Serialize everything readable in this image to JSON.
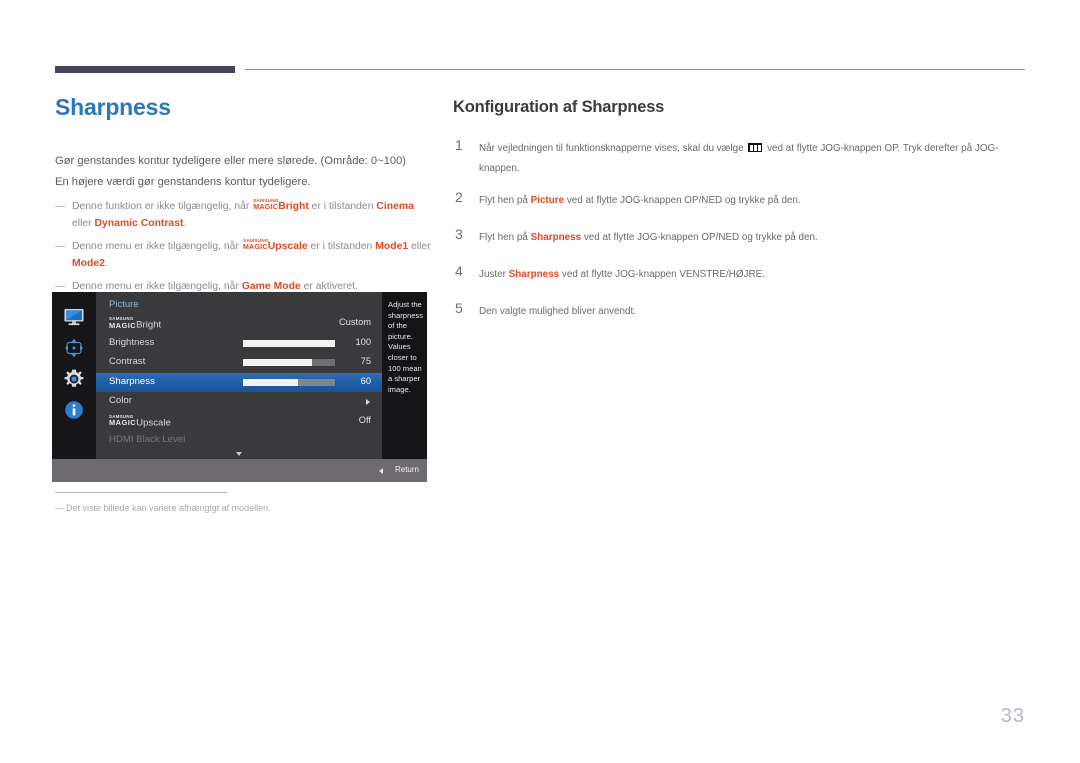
{
  "page": {
    "number": "33",
    "title": "Sharpness"
  },
  "left": {
    "intro_lines": [
      "Gør genstandes kontur tydeligere eller mere slørede. (Område: 0~100)",
      "En højere værdi gør genstandens kontur tydeligere."
    ],
    "notes": [
      {
        "dash": "―",
        "pre": "Denne funktion er ikke tilgængelig, når ",
        "logo_top": "SAMSUNG",
        "logo_bottom": "MAGIC",
        "logo_suffix": "Bright",
        "mid": " er i tilstanden ",
        "hl1": "Cinema",
        "mid2": " eller ",
        "hl2": "Dynamic Contrast",
        "post": "."
      },
      {
        "dash": "―",
        "pre": "Denne menu er ikke tilgængelig, når ",
        "logo_top": "SAMSUNG",
        "logo_bottom": "MAGIC",
        "logo_suffix": "Upscale",
        "mid": " er i tilstanden ",
        "hl1": "Mode1",
        "mid2": " eller ",
        "hl2": "Mode2",
        "post": "."
      },
      {
        "dash": "―",
        "pre": "Denne menu er ikke tilgængelig, når ",
        "hl1": "Game Mode",
        "post": " er aktiveret."
      }
    ],
    "footnote": {
      "dash": "―",
      "text": "Det viste billede kan variere afhængigt af modellen."
    }
  },
  "osd": {
    "menu_header": "Picture",
    "sidebar_icons": [
      "display-icon",
      "position-arrows-icon",
      "gear-icon",
      "info-icon"
    ],
    "rows": [
      {
        "name": "magicbright",
        "logo_top": "SAMSUNG",
        "logo_bottom": "MAGIC",
        "label": "Bright",
        "value": "Custom",
        "type": "value",
        "selected": false,
        "dim": false
      },
      {
        "name": "brightness",
        "label": "Brightness",
        "value": "100",
        "type": "slider",
        "fill": 100,
        "selected": false,
        "dim": false
      },
      {
        "name": "contrast",
        "label": "Contrast",
        "value": "75",
        "type": "slider",
        "fill": 75,
        "selected": false,
        "dim": false
      },
      {
        "name": "sharpness",
        "label": "Sharpness",
        "value": "60",
        "type": "slider",
        "fill": 60,
        "selected": true,
        "dim": false
      },
      {
        "name": "color",
        "label": "Color",
        "value": "",
        "type": "submenu",
        "selected": false,
        "dim": false
      },
      {
        "name": "magicupscale",
        "logo_top": "SAMSUNG",
        "logo_bottom": "MAGIC",
        "label": "Upscale",
        "value": "Off",
        "type": "value",
        "selected": false,
        "dim": false
      },
      {
        "name": "hdmi-black-level",
        "label": "HDMI Black Level",
        "value": "",
        "type": "value",
        "selected": false,
        "dim": true
      }
    ],
    "help_text": "Adjust the sharpness of the picture. Values closer to 100 mean a sharper image.",
    "footer_label": "Return"
  },
  "right": {
    "section_title": "Konfiguration af Sharpness",
    "steps": [
      {
        "num": "1",
        "pre": "Når vejledningen til funktionsknapperne vises, skal du vælge ",
        "glyph": "menu-icon",
        "post": " ved at flytte JOG-knappen OP. Tryk derefter på JOG-knappen."
      },
      {
        "num": "2",
        "pre": "Flyt hen på ",
        "hl": "Picture",
        "post": " ved at flytte JOG-knappen OP/NED og trykke på den."
      },
      {
        "num": "3",
        "pre": "Flyt hen på ",
        "hl": "Sharpness",
        "post": " ved at flytte JOG-knappen OP/NED og trykke på den."
      },
      {
        "num": "4",
        "pre": "Juster ",
        "hl": "Sharpness",
        "post": " ved at flytte JOG-knappen VENSTRE/HØJRE."
      },
      {
        "num": "5",
        "pre": "Den valgte mulighed bliver anvendt.",
        "hl": "",
        "post": ""
      }
    ]
  },
  "colors": {
    "title_blue": "#2e77bc",
    "highlight_red": "#e04a22",
    "rule_dark": "#454459",
    "osd_selected_blue": "#1f5ea8"
  }
}
